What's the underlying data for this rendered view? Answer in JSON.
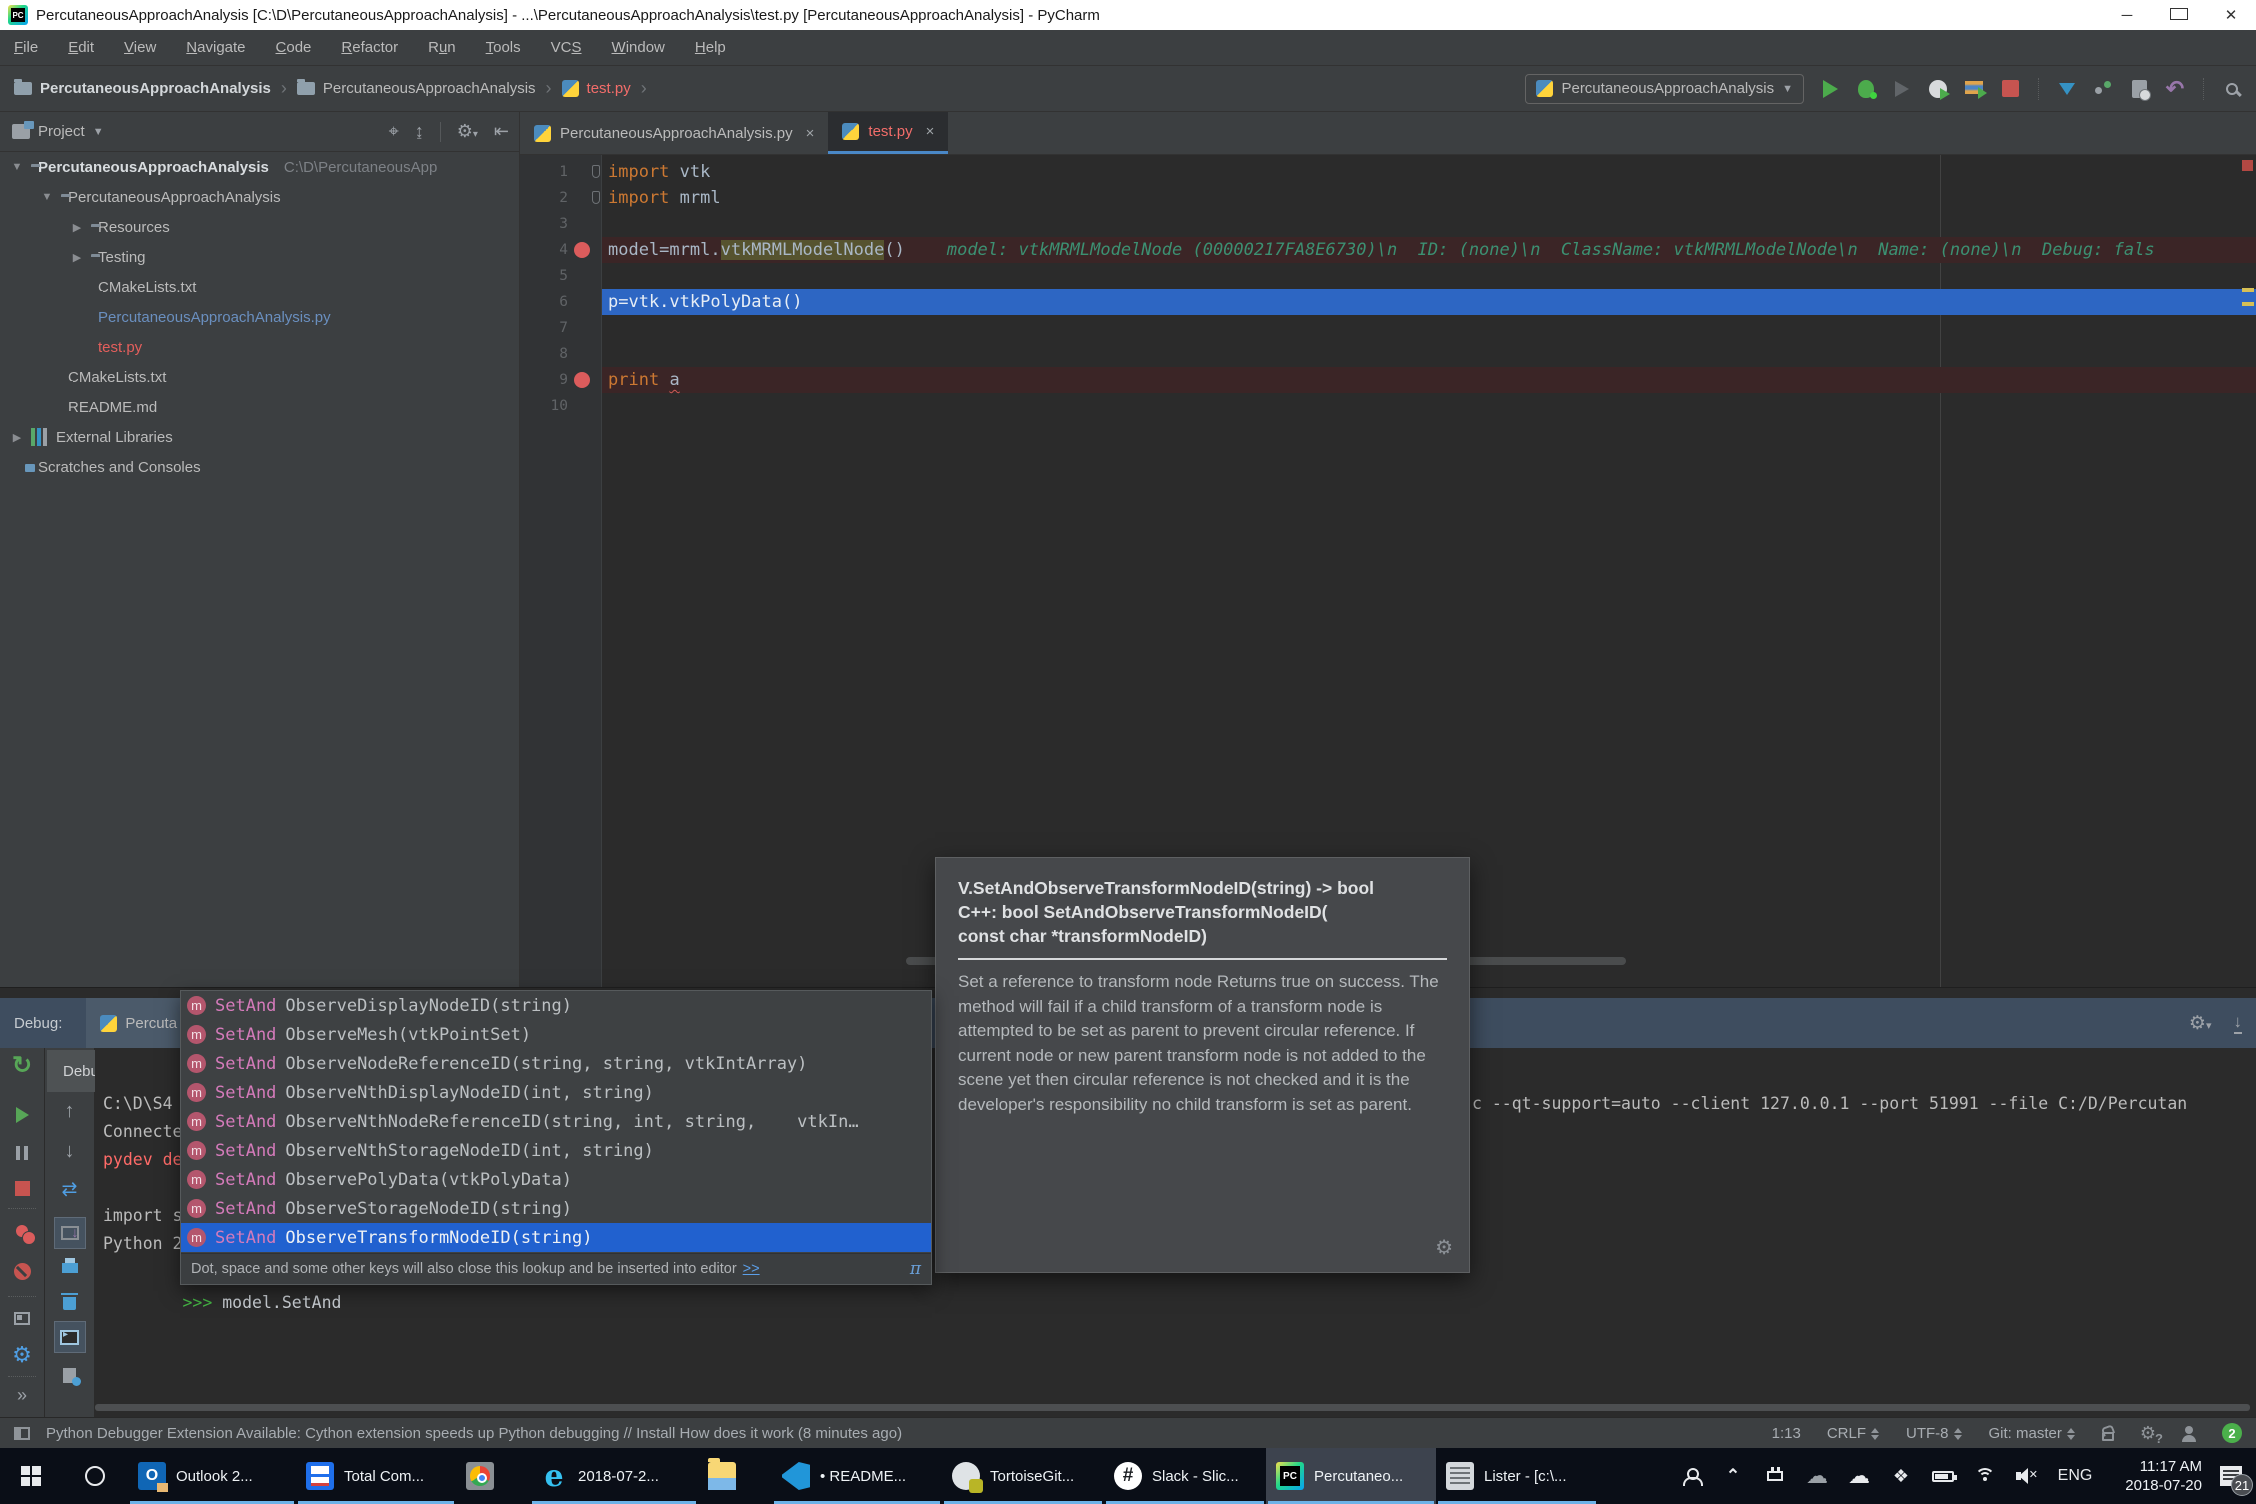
{
  "window": {
    "title": "PercutaneousApproachAnalysis [C:\\D\\PercutaneousApproachAnalysis] - ...\\PercutaneousApproachAnalysis\\test.py [PercutaneousApproachAnalysis] - PyCharm"
  },
  "menu": {
    "items": [
      {
        "label": "File",
        "m": 0
      },
      {
        "label": "Edit",
        "m": 0
      },
      {
        "label": "View",
        "m": 0
      },
      {
        "label": "Navigate",
        "m": 0
      },
      {
        "label": "Code",
        "m": 0
      },
      {
        "label": "Refactor",
        "m": 0
      },
      {
        "label": "Run",
        "m": 1
      },
      {
        "label": "Tools",
        "m": 0
      },
      {
        "label": "VCS",
        "m": 2
      },
      {
        "label": "Window",
        "m": 0
      },
      {
        "label": "Help",
        "m": 0
      }
    ]
  },
  "navbar": {
    "breadcrumbs": [
      {
        "label": "PercutaneousApproachAnalysis",
        "icon": "folder",
        "bold": true,
        "color": "#d3d7da"
      },
      {
        "label": "PercutaneousApproachAnalysis",
        "icon": "folder",
        "bold": false,
        "color": "#bbbbbb"
      },
      {
        "label": "test.py",
        "icon": "python",
        "bold": false,
        "color": "#f26d6a"
      }
    ],
    "run_config": "PercutaneousApproachAnalysis",
    "toolbar_icons": [
      "run",
      "debug",
      "coverage",
      "profiler",
      "concurrency",
      "stop",
      "separator",
      "update-project",
      "share",
      "commit-history",
      "rollback",
      "separator",
      "search-everywhere"
    ]
  },
  "project_panel": {
    "header": {
      "title": "Project",
      "icons": [
        "locate",
        "collapse-all",
        "separator",
        "settings",
        "hide"
      ]
    },
    "tree": [
      {
        "label": "PercutaneousApproachAnalysis",
        "suffix": "C:\\D\\PercutaneousApp",
        "level": 0,
        "icon": "folder",
        "arrow": "down",
        "bold": true,
        "color": "#d8dcdf"
      },
      {
        "label": "PercutaneousApproachAnalysis",
        "level": 1,
        "icon": "folder",
        "arrow": "down",
        "color": "#bbbbbb"
      },
      {
        "label": "Resources",
        "level": 2,
        "icon": "folder",
        "arrow": "right",
        "color": "#bbbbbb"
      },
      {
        "label": "Testing",
        "level": 2,
        "icon": "folder",
        "arrow": "right",
        "color": "#bbbbbb"
      },
      {
        "label": "CMakeLists.txt",
        "level": 2,
        "icon": "text",
        "color": "#bbbbbb"
      },
      {
        "label": "PercutaneousApproachAnalysis.py",
        "level": 2,
        "icon": "python",
        "color": "#6a8fbf"
      },
      {
        "label": "test.py",
        "level": 2,
        "icon": "python",
        "color": "#e35f5c"
      },
      {
        "label": "CMakeLists.txt",
        "level": 1,
        "icon": "text",
        "color": "#bbbbbb"
      },
      {
        "label": "README.md",
        "level": 1,
        "icon": "text",
        "color": "#bbbbbb"
      },
      {
        "label": "External Libraries",
        "level": 0,
        "icon": "library",
        "arrow": "right",
        "color": "#bbbbbb"
      },
      {
        "label": "Scratches and Consoles",
        "level": 0,
        "icon": "scratch",
        "color": "#bbbbbb"
      }
    ]
  },
  "editor": {
    "tabs": [
      {
        "label": "PercutaneousApproachAnalysis.py",
        "active": false,
        "color": "#bbbbbb"
      },
      {
        "label": "test.py",
        "active": true,
        "color": "#f26d6a"
      }
    ],
    "lines": [
      {
        "num": "1",
        "gutter": "fold",
        "segments": [
          {
            "text": "import",
            "c": "kw"
          },
          {
            "text": " vtk",
            "c": "plain"
          }
        ]
      },
      {
        "num": "2",
        "gutter": "fold",
        "segments": [
          {
            "text": "import",
            "c": "kw"
          },
          {
            "text": " mrml",
            "c": "plain"
          }
        ]
      },
      {
        "num": "3",
        "segments": []
      },
      {
        "num": "4",
        "breakpoint": true,
        "segments": [
          {
            "text": "model=mrml.",
            "c": "plain"
          },
          {
            "text": "vtkMRMLModelNode",
            "c": "plain",
            "hl": true
          },
          {
            "text": "()",
            "c": "plain"
          }
        ],
        "inline_watch": "model: vtkMRMLModelNode (00000217FA8E6730)\\n  ID: (none)\\n  ClassName: vtkMRMLModelNode\\n  Name: (none)\\n  Debug: fals"
      },
      {
        "num": "5",
        "segments": []
      },
      {
        "num": "6",
        "exec": true,
        "segments": [
          {
            "text": "p=vtk.vtkPolyData()",
            "c": "plain"
          }
        ]
      },
      {
        "num": "7",
        "segments": []
      },
      {
        "num": "8",
        "segments": []
      },
      {
        "num": "9",
        "breakpoint": true,
        "segments": [
          {
            "text": "print",
            "c": "kw"
          },
          {
            "text": " ",
            "c": "plain"
          },
          {
            "text": "a",
            "c": "plain",
            "squiggle": true
          }
        ]
      },
      {
        "num": "10",
        "segments": []
      }
    ]
  },
  "completion": {
    "items": [
      {
        "match": "SetAnd",
        "rest": "ObserveDisplayNodeID(string)",
        "selected": false
      },
      {
        "match": "SetAnd",
        "rest": "ObserveMesh(vtkPointSet)",
        "selected": false
      },
      {
        "match": "SetAnd",
        "rest": "ObserveNodeReferenceID(string, string, vtkIntArray)",
        "selected": false
      },
      {
        "match": "SetAnd",
        "rest": "ObserveNthDisplayNodeID(int, string)",
        "selected": false
      },
      {
        "match": "SetAnd",
        "rest": "ObserveNthNodeReferenceID(string, int, string,    vtkIn…",
        "selected": false
      },
      {
        "match": "SetAnd",
        "rest": "ObserveNthStorageNodeID(int, string)",
        "selected": false
      },
      {
        "match": "SetAnd",
        "rest": "ObservePolyData(vtkPolyData)",
        "selected": false
      },
      {
        "match": "SetAnd",
        "rest": "ObserveStorageNodeID(string)",
        "selected": false
      },
      {
        "match": "SetAnd",
        "rest": "ObserveTransformNodeID(string)",
        "selected": true
      }
    ],
    "hint": "Dot, space and some other keys will also close this lookup and be inserted into editor",
    "hint_link": ">>",
    "pi": "π"
  },
  "doc_popup": {
    "signature_lines": [
      "V.SetAndObserveTransformNodeID(string) -> bool",
      "C++: bool SetAndObserveTransformNodeID(",
      "const char *transformNodeID)"
    ],
    "body": "Set a reference to transform node Returns true on success. The method will fail if a child transform of a transform node is attempted to be set as parent to prevent circular reference. If current node or new parent transform node is not added to the scene yet then circular reference is not checked and it is the developer's responsibility no child transform is set as parent."
  },
  "debug_panel": {
    "label": "Debug:",
    "session": "Percuta",
    "tab": "Debugger",
    "left_toolbar_icons": [
      "rerun",
      "resume",
      "pause",
      "stop",
      "separator",
      "view-breakpoints",
      "mute-breakpoints",
      "separator",
      "restore-layout",
      "settings",
      "separator",
      "more"
    ],
    "console_toolbar_icons": [
      "up",
      "down",
      "sync",
      "force-step",
      "print",
      "clear",
      "console",
      "timeline"
    ],
    "console_left_lines": [
      "C:\\D\\S4",
      "Connecte",
      "pydev de",
      "",
      "import s",
      "Python 2"
    ],
    "console_right_line": "c --qt-support=auto --client 127.0.0.1 --port 51991 --file C:/D/Percutan",
    "prompt": ">>>",
    "prompt_input": "model.SetAnd"
  },
  "status_bar": {
    "message": "Python Debugger Extension Available: Cython extension speeds up Python debugging // Install How does it work (8 minutes ago)",
    "position": "1:13",
    "line_separator": "CRLF",
    "encoding": "UTF-8",
    "vcs": "Git: master",
    "notifications": "2"
  },
  "taskbar": {
    "apps": [
      {
        "label": "Outlook 2...",
        "icon": "outlook",
        "open": true,
        "active": false
      },
      {
        "label": "Total Com...",
        "icon": "totalcmd",
        "open": true,
        "active": false
      },
      {
        "label": "",
        "icon": "chrome",
        "open": false,
        "active": false
      },
      {
        "label": "2018-07-2...",
        "icon": "edge",
        "open": true,
        "active": false
      },
      {
        "label": "",
        "icon": "explorer",
        "open": false,
        "active": false
      },
      {
        "label": "• README...",
        "icon": "vscode",
        "open": true,
        "active": false
      },
      {
        "label": "TortoiseGit...",
        "icon": "tortoisegit",
        "open": true,
        "active": false
      },
      {
        "label": "Slack - Slic...",
        "icon": "slack",
        "open": true,
        "active": false
      },
      {
        "label": "Percutaneo...",
        "icon": "pycharm",
        "open": true,
        "active": true
      },
      {
        "label": "Lister - [c:\\...",
        "icon": "lister",
        "open": true,
        "active": false
      }
    ],
    "tray_icons": [
      "people",
      "chevron-up",
      "usb",
      "cloud-gray",
      "cloud-white",
      "dropbox",
      "battery",
      "wifi",
      "volume-muted"
    ],
    "language": "ENG",
    "clock_time": "11:17 AM",
    "clock_date": "2018-07-20",
    "notification_count": "21"
  },
  "colors": {
    "exec_line": "#2d66c3",
    "breakpoint_line": "#3b2526",
    "breakpoint_dot": "#db5c5c",
    "selection_blue": "#2161cf",
    "keyword_orange": "#cc7832",
    "inline_watch_green": "#3c9072",
    "error_red": "#ff6b68",
    "taskbar_underline": "#6cb2e8"
  }
}
